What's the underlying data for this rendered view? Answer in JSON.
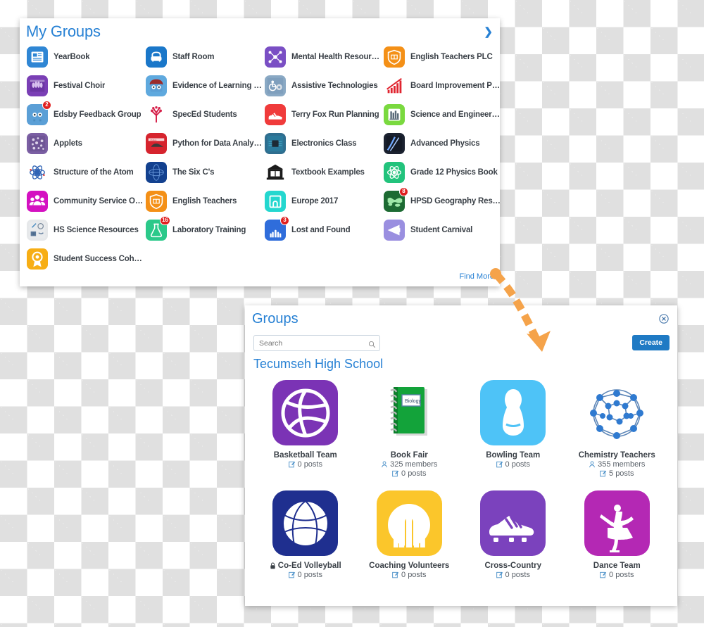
{
  "my_groups": {
    "title": "My Groups",
    "expand_icon": "chevron-right-icon",
    "find_more_label": "Find More",
    "items": [
      {
        "label": "YearBook",
        "icon": "newspaper-icon",
        "badge": null
      },
      {
        "label": "Staff Room",
        "icon": "armchair-icon",
        "badge": null
      },
      {
        "label": "Mental Health Resources",
        "icon": "network-nodes-icon",
        "badge": null
      },
      {
        "label": "English Teachers PLC",
        "icon": "shield-book-icon",
        "badge": null
      },
      {
        "label": "Festival Choir",
        "icon": "choir-photo-icon",
        "badge": null
      },
      {
        "label": "Evidence of Learning (P...",
        "icon": "robot-hat-icon",
        "badge": null
      },
      {
        "label": "Assistive Technologies",
        "icon": "wheelchair-gear-icon",
        "badge": null
      },
      {
        "label": "Board Improvement Plan",
        "icon": "bar-chart-up-icon",
        "badge": null
      },
      {
        "label": "Edsby Feedback Group",
        "icon": "robot-icon",
        "badge": "2"
      },
      {
        "label": "SpecEd Students",
        "icon": "red-tree-icon",
        "badge": null
      },
      {
        "label": "Terry Fox Run Planning",
        "icon": "running-shoe-icon",
        "badge": null
      },
      {
        "label": "Science and Engineering",
        "icon": "books-shelf-icon",
        "badge": null
      },
      {
        "label": "Applets",
        "icon": "particles-icon",
        "badge": null
      },
      {
        "label": "Python for Data Analysis",
        "icon": "python-book-icon",
        "badge": null
      },
      {
        "label": "Electronics Class",
        "icon": "circuit-board-icon",
        "badge": null
      },
      {
        "label": "Advanced Physics",
        "icon": "lightning-icon",
        "badge": null
      },
      {
        "label": "Structure of the Atom",
        "icon": "atom-icon",
        "badge": null
      },
      {
        "label": "The Six C's",
        "icon": "blue-globe-icon",
        "badge": null
      },
      {
        "label": "Textbook Examples",
        "icon": "library-book-icon",
        "badge": null
      },
      {
        "label": "Grade 12 Physics Book",
        "icon": "atom-green-icon",
        "badge": null
      },
      {
        "label": "Community Service Opps",
        "icon": "people-group-icon",
        "badge": null
      },
      {
        "label": "English Teachers",
        "icon": "shield-book-icon",
        "badge": null
      },
      {
        "label": "Europe 2017",
        "icon": "arch-icon",
        "badge": null
      },
      {
        "label": "HPSD Geography Reso...",
        "icon": "world-map-icon",
        "badge": "8"
      },
      {
        "label": "HS Science Resources",
        "icon": "science-tools-icon",
        "badge": null
      },
      {
        "label": "Laboratory Training",
        "icon": "flask-icon",
        "badge": "16"
      },
      {
        "label": "Lost and Found",
        "icon": "raised-hands-icon",
        "badge": "3"
      },
      {
        "label": "Student Carnival",
        "icon": "megaphone-icon",
        "badge": null
      },
      {
        "label": "Student Success Cohort",
        "icon": "award-ribbon-icon",
        "badge": null
      }
    ]
  },
  "groups_panel": {
    "title": "Groups",
    "close_icon": "close-circle-icon",
    "search": {
      "placeholder": "Search",
      "value": "",
      "icon": "search-icon"
    },
    "create_label": "Create",
    "school": "Tecumseh High School",
    "cards": [
      {
        "title": "Basketball Team",
        "icon": "volleyball-icon",
        "bg": "#7b33b5",
        "locked": false,
        "members": null,
        "posts": "0 posts"
      },
      {
        "title": "Book Fair",
        "icon": "green-notebook-icon",
        "bg": "#ffffff",
        "locked": false,
        "members": "325 members",
        "posts": "0 posts"
      },
      {
        "title": "Bowling Team",
        "icon": "bowling-pin-icon",
        "bg": "#4ec3f7",
        "locked": false,
        "members": null,
        "posts": "0 posts"
      },
      {
        "title": "Chemistry Teachers",
        "icon": "molecule-icon",
        "bg": "#ffffff",
        "locked": false,
        "members": "355 members",
        "posts": "5 posts"
      },
      {
        "title": "Co-Ed Volleyball",
        "icon": "volleyball-ball-icon",
        "bg": "#1f2f8f",
        "locked": true,
        "members": null,
        "posts": "0 posts"
      },
      {
        "title": "Coaching Volunteers",
        "icon": "raised-hands-icon",
        "bg": "#fbc62b",
        "locked": false,
        "members": null,
        "posts": "0 posts"
      },
      {
        "title": "Cross-Country",
        "icon": "cleat-shoe-icon",
        "bg": "#7b42bd",
        "locked": false,
        "members": null,
        "posts": "0 posts"
      },
      {
        "title": "Dance Team",
        "icon": "ballerina-icon",
        "bg": "#b428b4",
        "locked": false,
        "members": null,
        "posts": "0 posts"
      }
    ]
  },
  "annotation": {
    "arrow_icon": "curved-dashed-arrow-icon",
    "arrow_color": "#f5a councillor"
  },
  "colors": {
    "accent_blue": "#2781d4",
    "button_blue": "#1f7ac4",
    "badge_red": "#e02020",
    "arrow_orange": "#f5a34a",
    "text_dark": "#3a4047"
  }
}
